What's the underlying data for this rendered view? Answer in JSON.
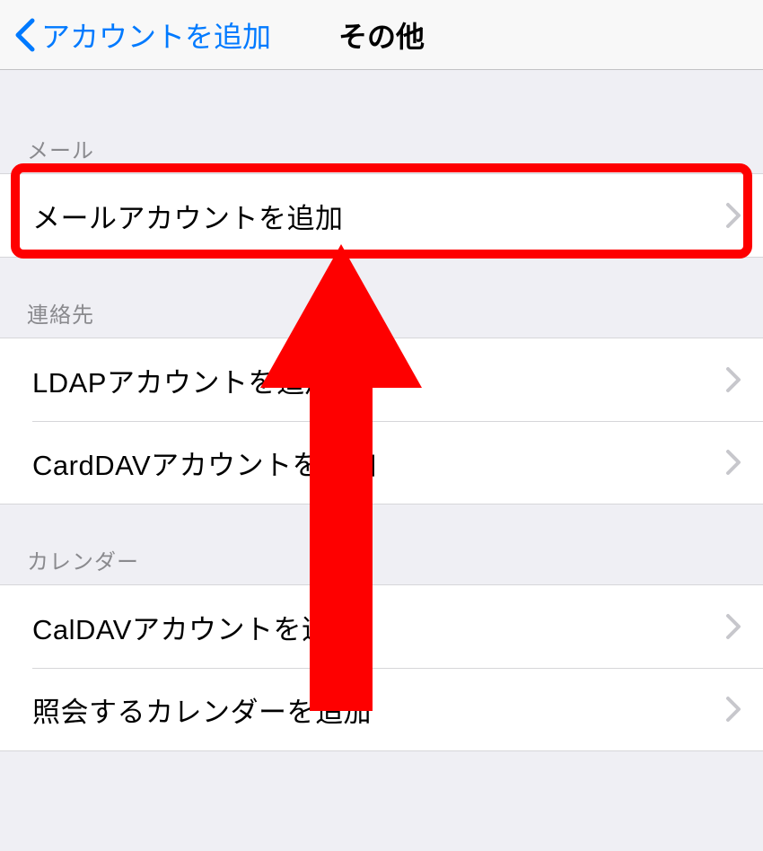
{
  "nav": {
    "back_label": "アカウントを追加",
    "title": "その他"
  },
  "sections": {
    "mail": {
      "header": "メール",
      "items": [
        {
          "label": "メールアカウントを追加"
        }
      ]
    },
    "contacts": {
      "header": "連絡先",
      "items": [
        {
          "label": "LDAPアカウントを追加"
        },
        {
          "label": "CardDAVアカウントを追加"
        }
      ]
    },
    "calendar": {
      "header": "カレンダー",
      "items": [
        {
          "label": "CalDAVアカウントを追加"
        },
        {
          "label": "照会するカレンダーを追加"
        }
      ]
    }
  },
  "annotation": {
    "highlight_color": "#fe0000"
  }
}
